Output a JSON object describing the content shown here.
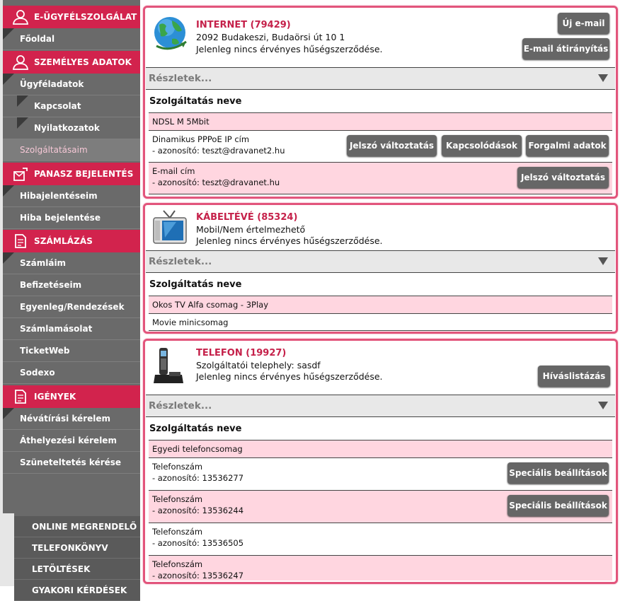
{
  "sidebar": {
    "sections": [
      {
        "title": "E-ÜGYFÉLSZOLGÁLAT",
        "icon": "user-icon"
      },
      {
        "title": "SZEMÉLYES ADATOK",
        "icon": "user-icon"
      },
      {
        "title": "PANASZ BEJELENTÉS",
        "icon": "mailbox-icon"
      },
      {
        "title": "SZÁMLÁZÁS",
        "icon": "documents-icon"
      },
      {
        "title": "IGÉNYEK",
        "icon": "documents-icon"
      }
    ],
    "items": {
      "foldal": "Főoldal",
      "ugyfeladatok": "Ügyféladatok",
      "kapcsolat": "Kapcsolat",
      "nyilatkozatok": "Nyilatkozatok",
      "szolgaltatasaim": "Szolgáltatásaim",
      "hibajelenteseim": "Hibajelentéseim",
      "hiba_bejelentese": "Hiba bejelentése",
      "szamlaim": "Számláim",
      "befizeteseim": "Befizetéseim",
      "egyenleg": "Egyenleg/Rendezések",
      "szamlamasolat": "Számlamásolat",
      "ticketweb": "TicketWeb",
      "sodexo": "Sodexo",
      "nevatirasi": "Névátírási kérelem",
      "athelyezesi": "Áthelyezési kérelem",
      "szuneteltetes": "Szüneteltetés kérése"
    },
    "bottom": [
      "ONLINE MEGRENDELŐ",
      "TELEFONKÖNYV",
      "LETÖLTÉSEK",
      "GYAKORI KÉRDÉSEK"
    ]
  },
  "common": {
    "details_label": "Részletek...",
    "service_name_header": "Szolgáltatás neve",
    "no_contract": "Jelenleg nincs érvényes hűségszerződése."
  },
  "internet": {
    "title": "INTERNET (79429)",
    "address": "2092 Budakeszi, Budaörsi út 10 1",
    "btn_new_email": "Új e-mail",
    "btn_redirect": "E-mail átirányítás",
    "row1": "NDSL M 5Mbit",
    "row2_title": "Dinamikus PPPoE IP cím",
    "row2_id": "- azonosító: teszt@dravanet2.hu",
    "row3_title": "E-mail cím",
    "row3_id": "- azonosító: teszt@dravanet.hu",
    "btn_pass": "Jelszó változtatás",
    "btn_conn": "Kapcsolódások",
    "btn_traffic": "Forgalmi adatok"
  },
  "tv": {
    "title": "KÁBELTÉVÉ (85324)",
    "address": "Mobil/Nem értelmezhető",
    "row1": "Okos TV Alfa csomag - 3Play",
    "row2": "Movie minicsomag"
  },
  "phone": {
    "title": "TELEFON (19927)",
    "address": "Szolgáltatói telephely: sasdf",
    "btn_calls": "Híváslistázás",
    "btn_special": "Speciális beállítások",
    "row1": "Egyedi telefoncsomag",
    "num_title": "Telefonszám",
    "ids": [
      "- azonosító: 13536277",
      "- azonosító: 13536244",
      "- azonosító: 13536505",
      "- azonosító: 13536247"
    ]
  }
}
